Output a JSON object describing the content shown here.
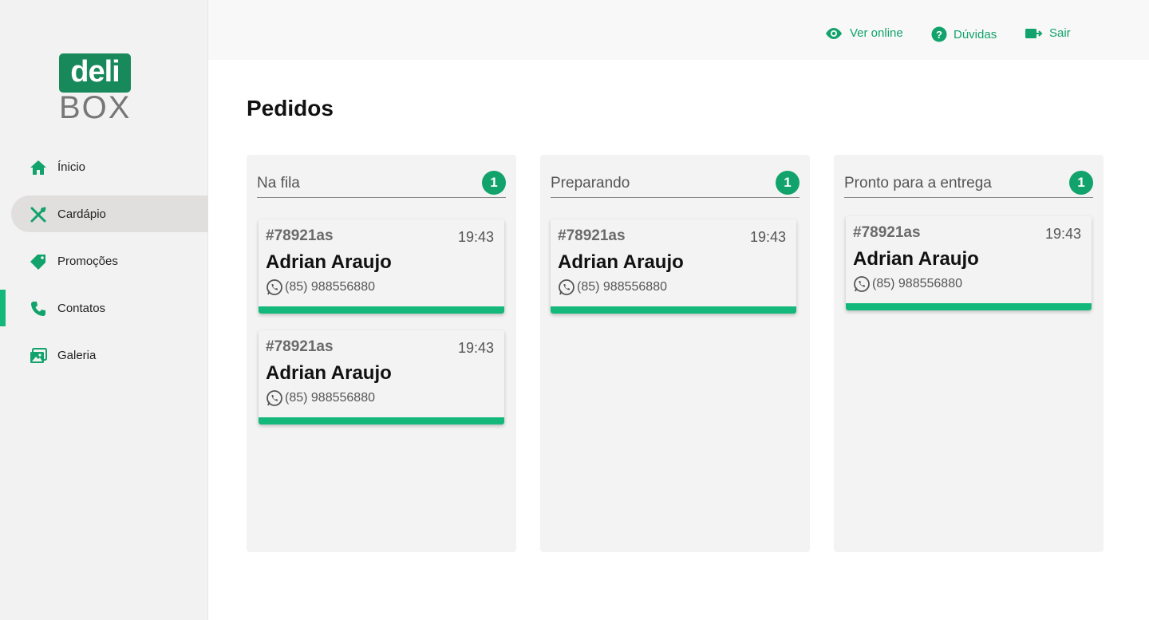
{
  "brand": {
    "logo_top": "deli",
    "logo_bottom": "BOX"
  },
  "sidebar": {
    "items": [
      {
        "label": "Ínicio",
        "icon": "home-icon"
      },
      {
        "label": "Cardápio",
        "icon": "utensils-icon"
      },
      {
        "label": "Promoções",
        "icon": "tag-icon"
      },
      {
        "label": "Contatos",
        "icon": "phone-icon"
      },
      {
        "label": "Galeria",
        "icon": "gallery-icon"
      }
    ]
  },
  "topbar": {
    "view_online": "Ver online",
    "help": "Dúvidas",
    "logout": "Sair"
  },
  "page": {
    "title": "Pedidos"
  },
  "columns": [
    {
      "title": "Na fila",
      "count": "1",
      "orders": [
        {
          "id": "#78921as",
          "time": "19:43",
          "name": "Adrian Araujo",
          "phone": "(85) 988556880"
        },
        {
          "id": "#78921as",
          "time": "19:43",
          "name": "Adrian Araujo",
          "phone": "(85) 988556880"
        }
      ]
    },
    {
      "title": "Preparando",
      "count": "1",
      "orders": [
        {
          "id": "#78921as",
          "time": "19:43",
          "name": "Adrian Araujo",
          "phone": "(85) 988556880"
        }
      ]
    },
    {
      "title": "Pronto para a entrega",
      "count": "1",
      "orders": [
        {
          "id": "#78921as",
          "time": "19:43",
          "name": "Adrian Araujo",
          "phone": "(85) 988556880"
        }
      ]
    }
  ],
  "colors": {
    "accent": "#14b87a",
    "brand": "#17895a",
    "sidebar_bg": "#f2f2f2",
    "active_bg": "#e1dfde"
  }
}
